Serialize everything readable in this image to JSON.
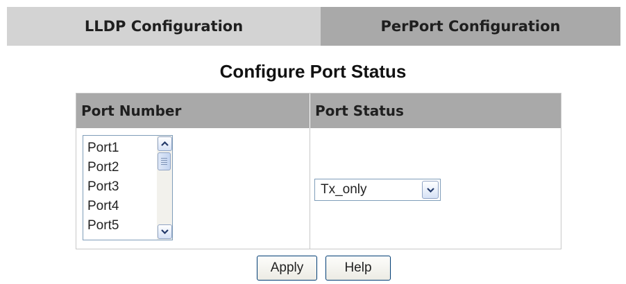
{
  "tabs": {
    "lldp_label": "LLDP Configuration",
    "perport_label": "PerPort Configuration"
  },
  "page": {
    "title": "Configure Port Status"
  },
  "table": {
    "headers": {
      "port_number": "Port Number",
      "port_status": "Port Status"
    }
  },
  "port_list": {
    "items": [
      "Port1",
      "Port2",
      "Port3",
      "Port4",
      "Port5"
    ]
  },
  "status_select": {
    "value": "Tx_only"
  },
  "buttons": {
    "apply": "Apply",
    "help": "Help"
  },
  "icons": {
    "scroll_up": "chevron-up-icon",
    "scroll_down": "chevron-down-icon",
    "select_arrow": "chevron-down-icon",
    "scroll_thumb": "grip-icon"
  },
  "colors": {
    "tab_inactive": "#d3d3d3",
    "tab_active": "#a9a9a9",
    "header_bg": "#a9a9a9",
    "control_border": "#7f9db9"
  }
}
